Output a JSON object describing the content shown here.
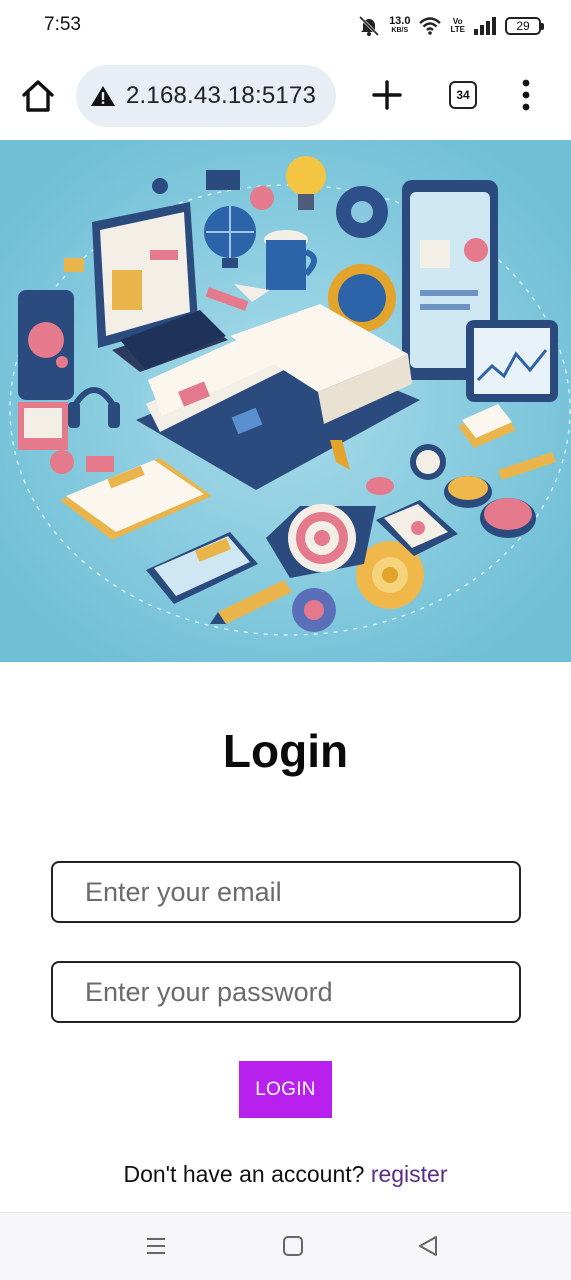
{
  "status_bar": {
    "time": "7:53",
    "net_speed_value": "13.0",
    "net_speed_unit": "KB/S",
    "volte_top": "Vo",
    "volte_bottom": "LTE",
    "battery": "29"
  },
  "browser": {
    "url": "2.168.43.18:5173",
    "tab_count": "34"
  },
  "login": {
    "title": "Login",
    "email_placeholder": "Enter your email",
    "password_placeholder": "Enter your password",
    "button_label": "LOGIN",
    "register_prompt": "Don't have an account?",
    "register_link": "register"
  },
  "colors": {
    "accent_button": "#b820ee",
    "link": "#5b2d86",
    "hero_background": "#7cc6da"
  },
  "icons": [
    "muted-bell-icon",
    "wifi-icon",
    "signal-icon",
    "battery-icon",
    "home-icon",
    "warning-icon",
    "plus-icon",
    "tabs-icon",
    "overflow-menu-icon",
    "recent-apps-icon",
    "home-nav-icon",
    "back-nav-icon"
  ]
}
